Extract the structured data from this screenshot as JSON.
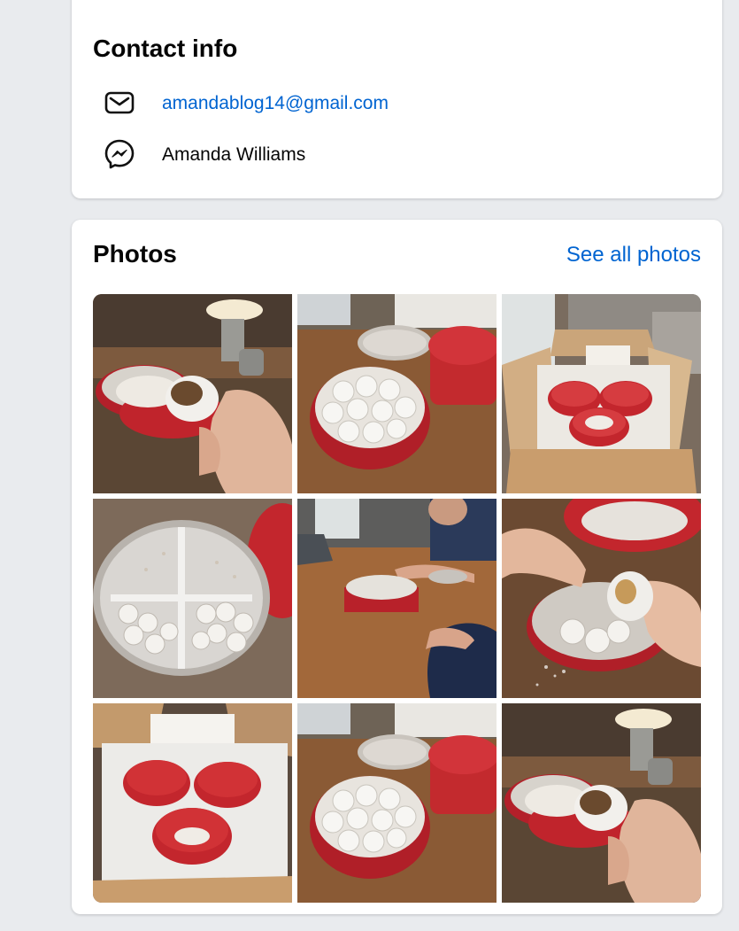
{
  "contact": {
    "title": "Contact info",
    "email": "amandablog14@gmail.com",
    "messenger": "Amanda Williams",
    "icons": {
      "email": "envelope-icon",
      "messenger": "messenger-icon"
    }
  },
  "photos": {
    "title": "Photos",
    "see_all": "See all photos",
    "items": [
      {
        "name": "photo-1",
        "desc": "hand holding bitten cookie over red tin"
      },
      {
        "name": "photo-2",
        "desc": "open red tin of powdered cookies on table"
      },
      {
        "name": "photo-3",
        "desc": "shipping box with three red tins"
      },
      {
        "name": "photo-4",
        "desc": "divided tray of powdered cookies"
      },
      {
        "name": "photo-5",
        "desc": "children reaching into red tin at table"
      },
      {
        "name": "photo-6",
        "desc": "hands taking cookie from tin"
      },
      {
        "name": "photo-7",
        "desc": "box with red tins wrapped in tissue"
      },
      {
        "name": "photo-8",
        "desc": "open red tin of powdered cookies on table"
      },
      {
        "name": "photo-9",
        "desc": "hand holding bitten cookie over red tin"
      }
    ]
  },
  "colors": {
    "link": "#0064d1",
    "tin_red": "#c8262d",
    "table_wood": "#8a5a35",
    "cookie": "#f1eeea",
    "page_bg": "#e9ebee"
  }
}
